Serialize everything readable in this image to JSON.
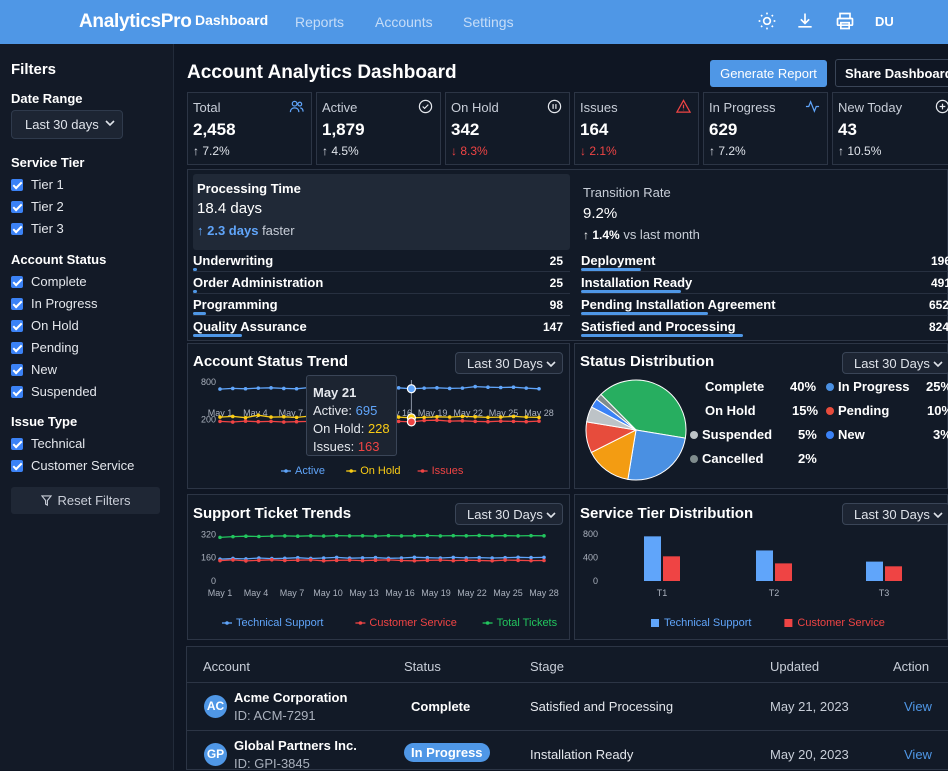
{
  "app": {
    "brand": "AnalyticsPro",
    "user": "DU"
  },
  "nav": [
    "Dashboard",
    "Reports",
    "Accounts",
    "Settings"
  ],
  "top_icons": [
    "sun-icon",
    "download-icon",
    "printer-icon"
  ],
  "sidebar": {
    "title": "Filters",
    "date_range_label": "Date Range",
    "date_range_value": "Last 30 days",
    "service_tier_label": "Service Tier",
    "service_tiers": [
      "Tier 1",
      "Tier 2",
      "Tier 3"
    ],
    "account_status_label": "Account Status",
    "account_statuses": [
      "Complete",
      "In Progress",
      "On Hold",
      "Pending",
      "New",
      "Suspended"
    ],
    "issue_type_label": "Issue Type",
    "issue_types": [
      "Technical",
      "Customer Service"
    ],
    "reset_label": "Reset Filters"
  },
  "header": {
    "title": "Account Analytics Dashboard",
    "generate_label": "Generate Report",
    "share_label": "Share Dashboard"
  },
  "kpis": [
    {
      "label": "Total",
      "value": "2,458",
      "change": "↑ 7.2%",
      "dir": "up",
      "icon": "users-icon"
    },
    {
      "label": "Active",
      "value": "1,879",
      "change": "↑ 4.5%",
      "dir": "up",
      "icon": "check-circle-icon"
    },
    {
      "label": "On Hold",
      "value": "342",
      "change": "↓ 8.3%",
      "dir": "down",
      "icon": "pause-circle-icon"
    },
    {
      "label": "Issues",
      "value": "164",
      "change": "↓ 2.1%",
      "dir": "down",
      "icon": "warning-icon"
    },
    {
      "label": "In Progress",
      "value": "629",
      "change": "↑ 7.2%",
      "dir": "up",
      "icon": "activity-icon"
    },
    {
      "label": "New Today",
      "value": "43",
      "change": "↑ 10.5%",
      "dir": "up",
      "icon": "plus-circle-icon"
    }
  ],
  "processing": {
    "label": "Processing Time",
    "value": "18.4 days",
    "delta": "↑ 2.3 days",
    "delta_suffix": "faster",
    "stages": [
      {
        "name": "Underwriting",
        "value": "25"
      },
      {
        "name": "Order Administration",
        "value": "25"
      },
      {
        "name": "Programming",
        "value": "98"
      },
      {
        "name": "Quality Assurance",
        "value": "147"
      }
    ]
  },
  "transition": {
    "label": "Transition Rate",
    "value": "9.2%",
    "delta": "↑ 1.4%",
    "delta_suffix": "vs last month",
    "stages": [
      {
        "name": "Deployment",
        "value": "196"
      },
      {
        "name": "Installation Ready",
        "value": "491"
      },
      {
        "name": "Pending Installation Agreement",
        "value": "652"
      },
      {
        "name": "Satisfied and Processing",
        "value": "824"
      }
    ]
  },
  "status_trend": {
    "title": "Account Status Trend",
    "range": "Last 30 Days",
    "tooltip": {
      "date": "May 21",
      "active_label": "Active:",
      "active": "695",
      "hold_label": "On Hold:",
      "hold": "228",
      "issues_label": "Issues:",
      "issues": "163"
    }
  },
  "status_distribution": {
    "title": "Status Distribution",
    "range": "Last 30 Days",
    "items": [
      {
        "name": "Complete",
        "pct": "40%",
        "color": "#27ae60"
      },
      {
        "name": "In Progress",
        "pct": "25%",
        "color": "#4a90e2"
      },
      {
        "name": "On Hold",
        "pct": "15%",
        "color": "#f39c12"
      },
      {
        "name": "Pending",
        "pct": "10%",
        "color": "#e74c3c"
      },
      {
        "name": "Suspended",
        "pct": "5%",
        "color": "#bdc3c7"
      },
      {
        "name": "New",
        "pct": "3%",
        "color": "#3b82f6"
      },
      {
        "name": "Cancelled",
        "pct": "2%",
        "color": "#7f8c8d"
      }
    ]
  },
  "support_trends": {
    "title": "Support Ticket Trends",
    "range": "Last 30 Days"
  },
  "tier_distribution": {
    "title": "Service Tier Distribution",
    "range": "Last 30 Days"
  },
  "table": {
    "headers": [
      "Account",
      "Status",
      "Stage",
      "Updated",
      "Action"
    ],
    "rows": [
      {
        "initials": "AC",
        "name": "Acme Corporation",
        "id": "ID: ACM-7291",
        "status": "Complete",
        "stage": "Satisfied and Processing",
        "updated": "May 21, 2023",
        "action": "View"
      },
      {
        "initials": "GP",
        "name": "Global Partners Inc.",
        "id": "ID: GPI-3845",
        "status": "In Progress",
        "stage": "Installation Ready",
        "updated": "May 20, 2023",
        "action": "View"
      }
    ]
  },
  "chart_data": [
    {
      "type": "line",
      "title": "Account Status Trend",
      "x": [
        "May 1",
        "May 4",
        "May 7",
        "May 10",
        "May 13",
        "May 16",
        "May 19",
        "May 22",
        "May 25",
        "May 28"
      ],
      "ylim": [
        0,
        900
      ],
      "yticks": [
        "800",
        "200"
      ],
      "series": [
        {
          "name": "Active",
          "color": "#60a5fa",
          "values": [
            690,
            700,
            695,
            705,
            710,
            700,
            695,
            715,
            720,
            730,
            705,
            715,
            720,
            700,
            710,
            695,
            705,
            710,
            700,
            705,
            730,
            720,
            715,
            720,
            705,
            695
          ]
        },
        {
          "name": "On Hold",
          "color": "#facc15",
          "values": [
            240,
            250,
            230,
            270,
            240,
            245,
            235,
            255,
            245,
            240,
            250,
            235,
            245,
            250,
            240,
            228,
            235,
            245,
            240,
            250,
            245,
            235,
            240,
            250,
            240,
            235
          ]
        },
        {
          "name": "Issues",
          "color": "#ef4444",
          "values": [
            170,
            160,
            175,
            165,
            170,
            160,
            165,
            170,
            180,
            165,
            175,
            170,
            160,
            165,
            170,
            163,
            185,
            190,
            175,
            180,
            170,
            165,
            175,
            170,
            165,
            175
          ]
        }
      ]
    },
    {
      "type": "pie",
      "title": "Status Distribution",
      "categories": [
        "Complete",
        "In Progress",
        "On Hold",
        "Pending",
        "Suspended",
        "New",
        "Cancelled"
      ],
      "values": [
        40,
        25,
        15,
        10,
        5,
        3,
        2
      ]
    },
    {
      "type": "line",
      "title": "Support Ticket Trends",
      "x": [
        "May 1",
        "May 4",
        "May 7",
        "May 10",
        "May 13",
        "May 16",
        "May 19",
        "May 22",
        "May 25",
        "May 28"
      ],
      "ylim": [
        0,
        330
      ],
      "yticks": [
        "320",
        "160",
        "0"
      ],
      "series": [
        {
          "name": "Technical Support",
          "color": "#60a5fa",
          "values": [
            150,
            155,
            152,
            158,
            154,
            156,
            160,
            155,
            158,
            162,
            157,
            159,
            161,
            156,
            158,
            163,
            160,
            158,
            162,
            159,
            161,
            158,
            160,
            163,
            161,
            162
          ]
        },
        {
          "name": "Customer Service",
          "color": "#ef4444",
          "values": [
            140,
            145,
            138,
            142,
            146,
            141,
            143,
            145,
            139,
            142,
            144,
            140,
            143,
            145,
            141,
            139,
            142,
            144,
            140,
            143,
            141,
            139,
            144,
            142,
            140,
            141
          ]
        },
        {
          "name": "Total Tickets",
          "color": "#22c55e",
          "values": [
            300,
            305,
            308,
            306,
            309,
            310,
            308,
            311,
            309,
            312,
            310,
            311,
            309,
            312,
            310,
            311,
            313,
            310,
            312,
            311,
            313,
            311,
            312,
            310,
            312,
            311
          ]
        }
      ]
    },
    {
      "type": "bar",
      "title": "Service Tier Distribution",
      "categories": [
        "T1",
        "T2",
        "T3"
      ],
      "ylim": [
        0,
        800
      ],
      "yticks": [
        "800",
        "400",
        "0"
      ],
      "series": [
        {
          "name": "Technical Support",
          "color": "#60a5fa",
          "values": [
            760,
            520,
            330
          ]
        },
        {
          "name": "Customer Service",
          "color": "#ef4444",
          "values": [
            420,
            300,
            250
          ]
        }
      ]
    }
  ]
}
